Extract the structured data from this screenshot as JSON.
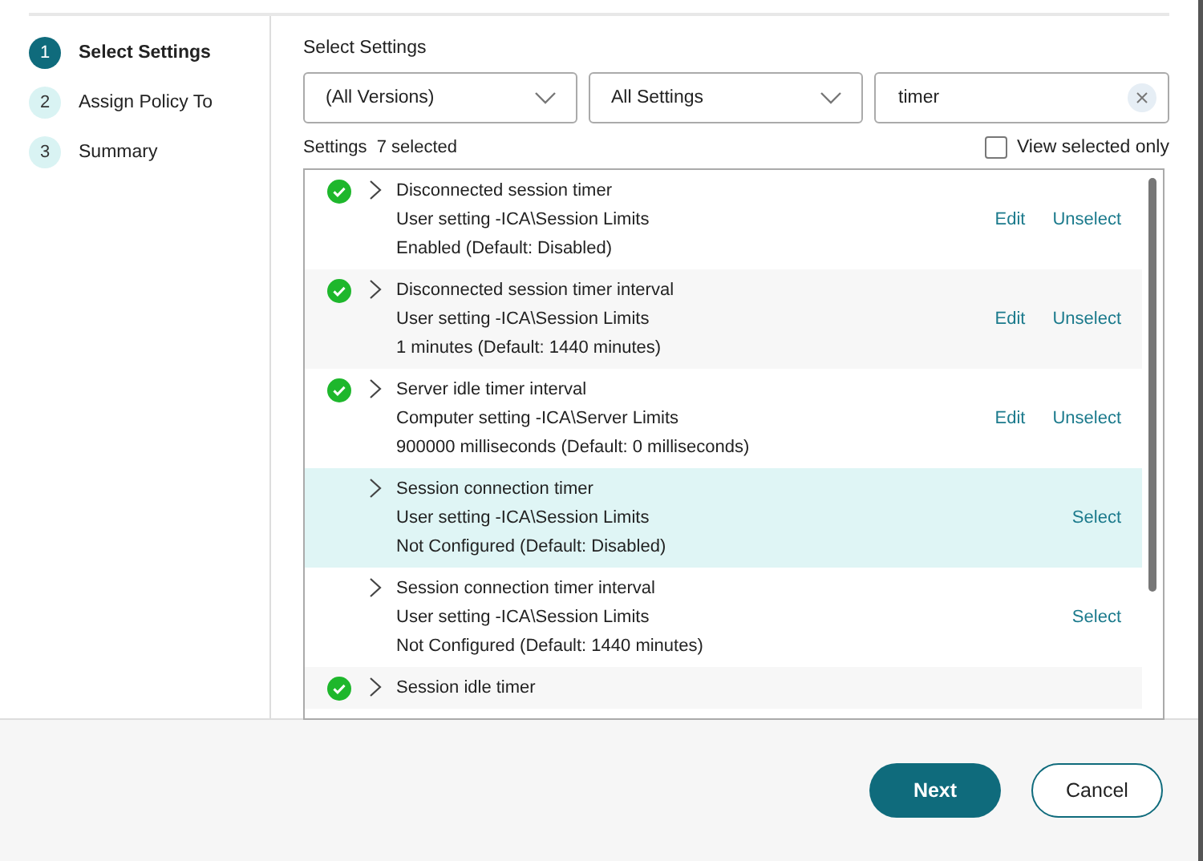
{
  "steps": [
    {
      "number": "1",
      "label": "Select Settings",
      "selected": true
    },
    {
      "number": "2",
      "label": "Assign Policy To",
      "selected": false
    },
    {
      "number": "3",
      "label": "Summary",
      "selected": false
    }
  ],
  "heading": "Select Settings",
  "filters": {
    "version": "(All Versions)",
    "category": "All Settings",
    "search": "timer"
  },
  "summary": {
    "label": "Settings",
    "count": "7 selected"
  },
  "view_selected_only": {
    "label": "View selected only",
    "checked": false
  },
  "settings": [
    {
      "name": "Disconnected session timer",
      "scope": "User setting -ICA\\Session Limits",
      "value": "Enabled (Default: Disabled)",
      "checked": true,
      "highlighted": false,
      "actions": [
        "Edit",
        "Unselect"
      ]
    },
    {
      "name": "Disconnected session timer interval",
      "scope": "User setting -ICA\\Session Limits",
      "value": "1 minutes (Default: 1440 minutes)",
      "checked": true,
      "highlighted": false,
      "actions": [
        "Edit",
        "Unselect"
      ]
    },
    {
      "name": "Server idle timer interval",
      "scope": "Computer setting -ICA\\Server Limits",
      "value": "900000 milliseconds (Default: 0 milliseconds)",
      "checked": true,
      "highlighted": false,
      "actions": [
        "Edit",
        "Unselect"
      ]
    },
    {
      "name": "Session connection timer",
      "scope": "User setting -ICA\\Session Limits",
      "value": "Not Configured (Default: Disabled)",
      "checked": false,
      "highlighted": true,
      "actions": [
        "Select"
      ]
    },
    {
      "name": "Session connection timer interval",
      "scope": "User setting -ICA\\Session Limits",
      "value": "Not Configured (Default: 1440 minutes)",
      "checked": false,
      "highlighted": false,
      "actions": [
        "Select"
      ]
    },
    {
      "name": "Session idle timer",
      "checked": true,
      "highlighted": false
    }
  ],
  "buttons": [
    {
      "label": "Next",
      "kind": "primary"
    },
    {
      "label": "Cancel",
      "kind": "secondary"
    }
  ]
}
